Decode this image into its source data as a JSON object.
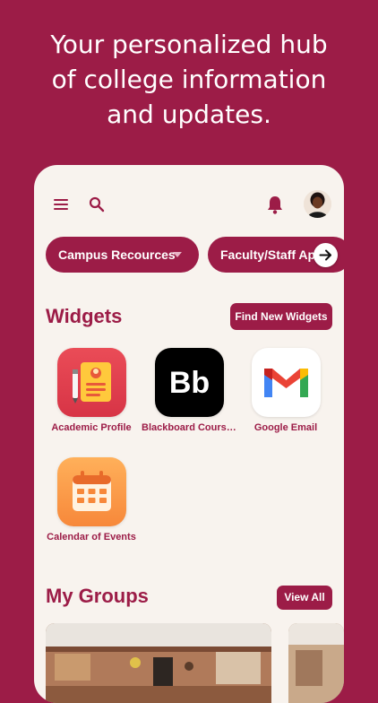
{
  "headline": "Your personalized hub\nof college information\nand updates.",
  "app": {
    "icons": {
      "menu": "hamburger-menu-icon",
      "search": "search-icon",
      "notifications": "bell-icon",
      "profile": "avatar"
    },
    "chips": [
      {
        "label": "Campus Recources"
      },
      {
        "label": "Faculty/Staff Apps"
      }
    ],
    "widgets": {
      "title": "Widgets",
      "action": "Find New Widgets",
      "items": [
        {
          "label": "Academic Profile",
          "icon": "academic-profile-icon"
        },
        {
          "label": "Blackboard Courses",
          "icon": "blackboard-icon",
          "icon_text": "Bb"
        },
        {
          "label": "Google Email",
          "icon": "gmail-icon"
        },
        {
          "label": "Calendar of Events",
          "icon": "calendar-icon"
        }
      ]
    },
    "groups": {
      "title": "My Groups",
      "action": "View All"
    },
    "colors": {
      "brand": "#9c1c47",
      "surface": "#f8f3ee"
    }
  }
}
